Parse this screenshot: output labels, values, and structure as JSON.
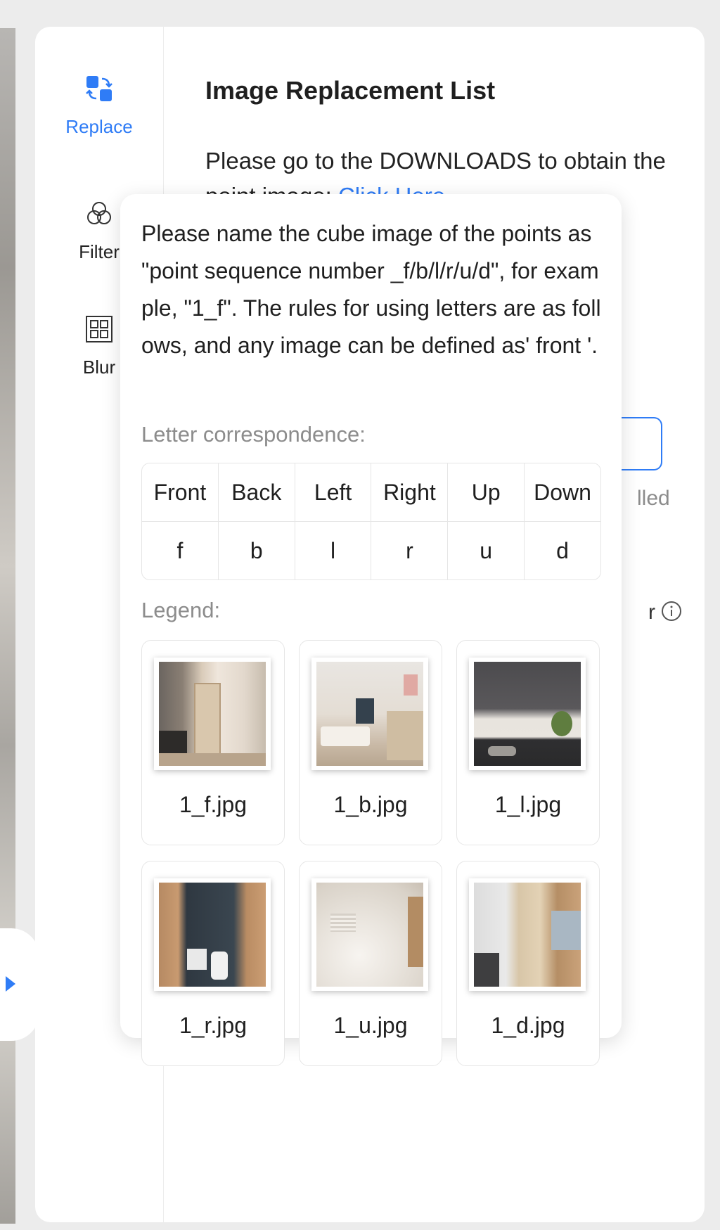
{
  "sidebar": {
    "items": [
      {
        "label": "Replace",
        "icon": "replace-icon",
        "active": true
      },
      {
        "label": "Filter",
        "icon": "filter-icon",
        "active": false
      },
      {
        "label": "Blur",
        "icon": "blur-icon",
        "active": false
      }
    ]
  },
  "main": {
    "title": "Image Replacement List",
    "desc_text": "Please go to the DOWNLOADS to obtain the point image: ",
    "link_text": "Click Here",
    "peek_1": "lled",
    "peek_2": "r"
  },
  "popover": {
    "text": "Please name the cube image of the points as \"point sequence number _f/b/l/r/u/d\", for example, \"1_f\". The rules for using letters are as follows, and any image can be defined as' front '.",
    "letter_label": "Letter correspondence:",
    "letters": {
      "headers": [
        "Front",
        "Back",
        "Left",
        "Right",
        "Up",
        "Down"
      ],
      "values": [
        "f",
        "b",
        "l",
        "r",
        "u",
        "d"
      ]
    },
    "legend_label": "Legend:",
    "legend": [
      {
        "name": "1_f.jpg"
      },
      {
        "name": "1_b.jpg"
      },
      {
        "name": "1_l.jpg"
      },
      {
        "name": "1_r.jpg"
      },
      {
        "name": "1_u.jpg"
      },
      {
        "name": "1_d.jpg"
      }
    ]
  },
  "colors": {
    "accent": "#2f7cf6",
    "muted": "#8c8c8c",
    "border": "#e6e6e6"
  }
}
